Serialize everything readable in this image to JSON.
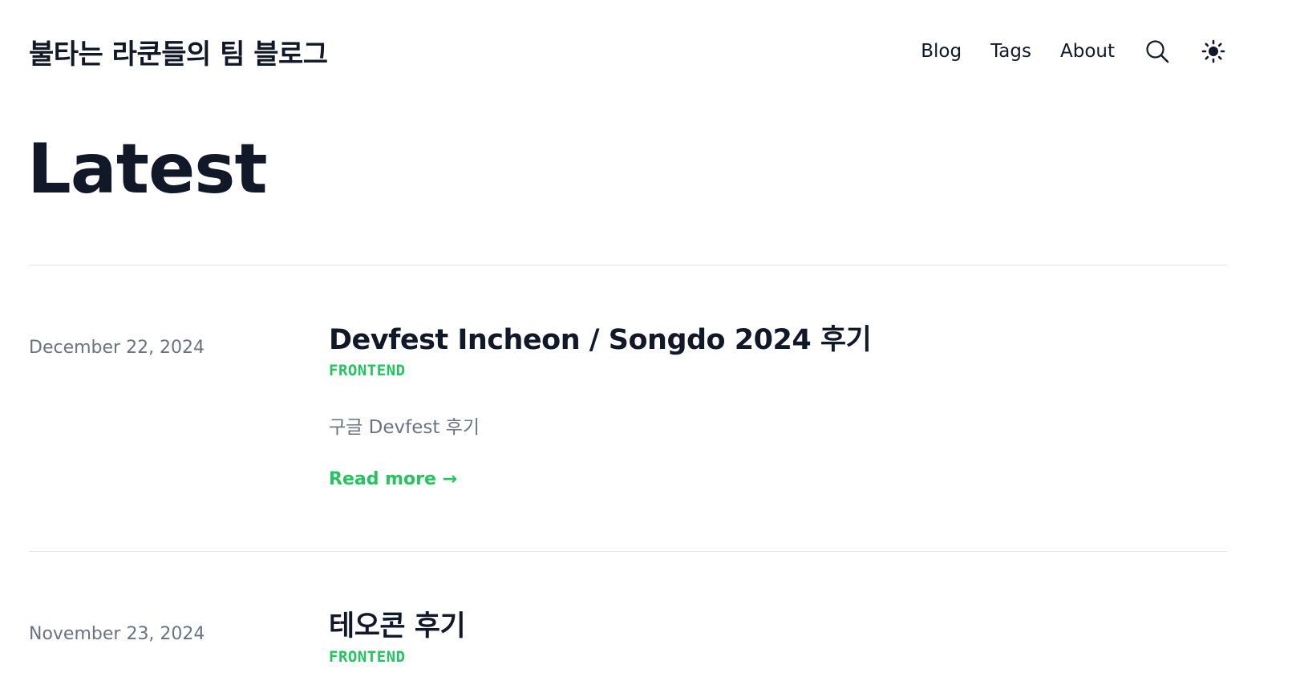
{
  "header": {
    "site_title": "불타는 라쿤들의 팀 블로그",
    "nav": [
      {
        "label": "Blog"
      },
      {
        "label": "Tags"
      },
      {
        "label": "About"
      }
    ],
    "icons": {
      "search": "search-icon",
      "theme": "sun-icon"
    }
  },
  "page": {
    "title": "Latest"
  },
  "posts": [
    {
      "date": "December 22, 2024",
      "title": "Devfest Incheon / Songdo 2024 후기",
      "tag": "FRONTEND",
      "summary": "구글 Devfest 후기",
      "read_more": "Read more →"
    },
    {
      "date": "November 23, 2024",
      "title": "테오콘 후기",
      "tag": "FRONTEND"
    }
  ],
  "colors": {
    "accent": "#22c55e",
    "text": "#111827",
    "muted": "#6b7280",
    "divider": "#e5e7eb"
  }
}
